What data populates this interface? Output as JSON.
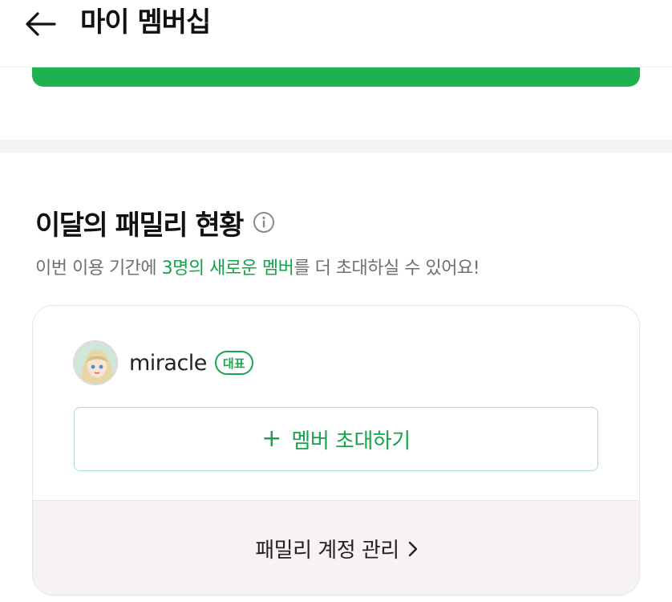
{
  "header": {
    "title": "마이 멤버십",
    "back_icon": "arrow-left-icon"
  },
  "family": {
    "title": "이달의 패밀리 현황",
    "info_icon": "info-icon",
    "desc_prefix": "이번 이용 기간에 ",
    "desc_highlight": "3명의 새로운 멤버",
    "desc_suffix": "를 더 초대하실 수 있어요!",
    "member": {
      "name": "miracle",
      "badge": "대표"
    },
    "invite_button": {
      "plus": "+",
      "label": "멤버 초대하기"
    },
    "manage_link": {
      "label": "패밀리 계정 관리"
    }
  },
  "colors": {
    "accent_green": "#1fb14f",
    "text_green": "#14a34a",
    "divider": "#f5f2f5"
  }
}
